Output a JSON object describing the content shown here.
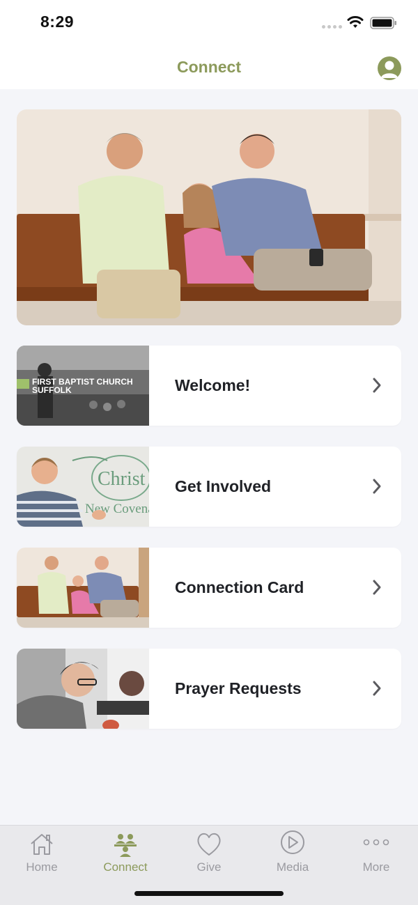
{
  "status_bar": {
    "time": "8:29"
  },
  "nav": {
    "title": "Connect",
    "profile_icon": "person-icon"
  },
  "hero": {
    "image": "church-members-on-pew-photo"
  },
  "cards": [
    {
      "label": "Welcome!",
      "thumb_text_line1": "FIRST BAPTIST CHURCH",
      "thumb_text_line2": "SUFFOLK"
    },
    {
      "label": "Get Involved",
      "thumb_text_line1": "Christ",
      "thumb_text_line2": "New Covena"
    },
    {
      "label": "Connection Card"
    },
    {
      "label": "Prayer Requests"
    }
  ],
  "tabs": [
    {
      "label": "Home",
      "icon": "house-icon",
      "active": false
    },
    {
      "label": "Connect",
      "icon": "people-icon",
      "active": true
    },
    {
      "label": "Give",
      "icon": "heart-icon",
      "active": false
    },
    {
      "label": "Media",
      "icon": "play-icon",
      "active": false
    },
    {
      "label": "More",
      "icon": "ellipsis-icon",
      "active": false
    }
  ],
  "colors": {
    "accent": "#8c9a5b",
    "background": "#f4f5f9",
    "tab_inactive": "#9a9aa0"
  }
}
